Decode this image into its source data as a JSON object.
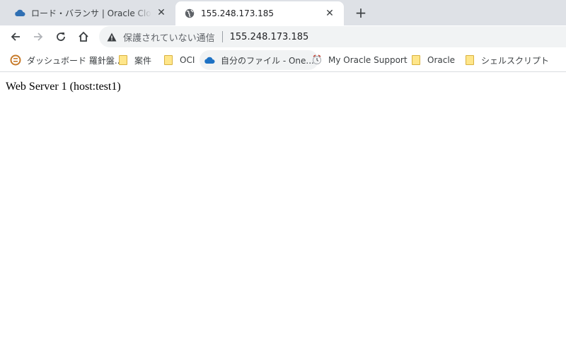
{
  "tabs": [
    {
      "title": "ロード・バランサ | Oracle Cloud Infra",
      "favicon": "oracle-cloud-icon",
      "active": false
    },
    {
      "title": "155.248.173.185",
      "favicon": "globe-icon",
      "active": true
    }
  ],
  "toolbar": {
    "security_label": "保護されていない通信",
    "url": "155.248.173.185"
  },
  "bookmarks": [
    {
      "label": "ダッシュボード 羅針盤...",
      "icon": "dashboard-icon"
    },
    {
      "label": "案件",
      "icon": "folder-icon"
    },
    {
      "label": "OCI",
      "icon": "folder-icon"
    },
    {
      "label": "自分のファイル - One...",
      "icon": "onedrive-icon"
    },
    {
      "label": "My Oracle Support",
      "icon": "oracle-support-icon"
    },
    {
      "label": "Oracle",
      "icon": "folder-icon"
    },
    {
      "label": "シェルスクリプト",
      "icon": "folder-icon"
    }
  ],
  "page": {
    "text": "Web Server 1 (host:test1)"
  },
  "colors": {
    "tabstrip_bg": "#dee1e6",
    "omnibox_bg": "#f1f3f4",
    "cloud_blue": "#2f6fb3",
    "folder_yellow": "#ffe68a"
  }
}
